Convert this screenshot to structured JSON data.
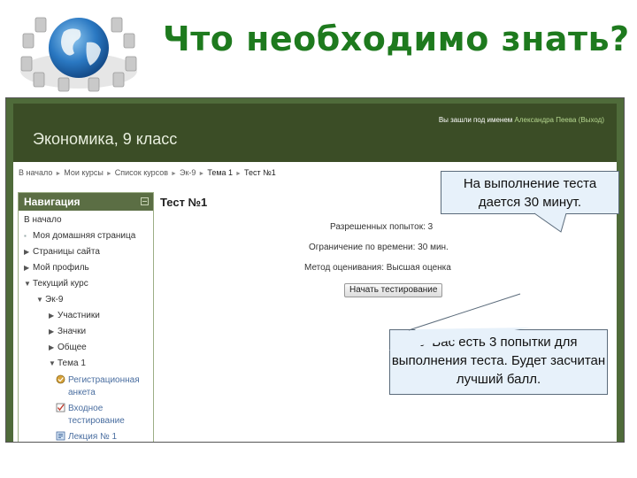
{
  "slide": {
    "title": "Что необходимо знать?"
  },
  "site": {
    "course_title": "Экономика, 9 класс",
    "login_prefix": "Вы зашли под именем",
    "login_user": "Александра Пеева",
    "logout": "(Выход)"
  },
  "breadcrumb": [
    "В начало",
    "Мои курсы",
    "Список курсов",
    "Эк-9",
    "Тема 1",
    "Тест №1"
  ],
  "navigation": {
    "header": "Навигация",
    "items": [
      {
        "label": "В начало",
        "marker": "none"
      },
      {
        "label": "Моя домашняя страница",
        "marker": "dot"
      },
      {
        "label": "Страницы сайта",
        "marker": "collapsed"
      },
      {
        "label": "Мой профиль",
        "marker": "collapsed"
      },
      {
        "label": "Текущий курс",
        "marker": "expanded"
      },
      {
        "label": "Эк-9",
        "marker": "expanded"
      },
      {
        "label": "Участники",
        "marker": "collapsed"
      },
      {
        "label": "Значки",
        "marker": "collapsed"
      },
      {
        "label": "Общее",
        "marker": "collapsed"
      },
      {
        "label": "Тема 1",
        "marker": "expanded"
      },
      {
        "label": "Регистрационная анкета",
        "icon": "feedback-icon"
      },
      {
        "label": "Входное тестирование",
        "icon": "quiz-icon"
      },
      {
        "label": "Лекция № 1",
        "icon": "lesson-icon"
      }
    ]
  },
  "quiz": {
    "title": "Тест №1",
    "attempts": "Разрешенных попыток: 3",
    "time_limit": "Ограничение по времени: 30 мин.",
    "grading": "Метод оценивания: Высшая оценка",
    "start_button": "Начать тестирование"
  },
  "callouts": {
    "time_note": "На выполнение теста дается 30 минут.",
    "attempts_note": "У Вас есть 3 попытки для выполнения теста. Будет засчитан лучший балл."
  },
  "colors": {
    "title_green": "#1e7a1e",
    "header_dark": "#3b4d26",
    "nav_header": "#5b6e44",
    "callout_bg": "#e7f1fa"
  }
}
